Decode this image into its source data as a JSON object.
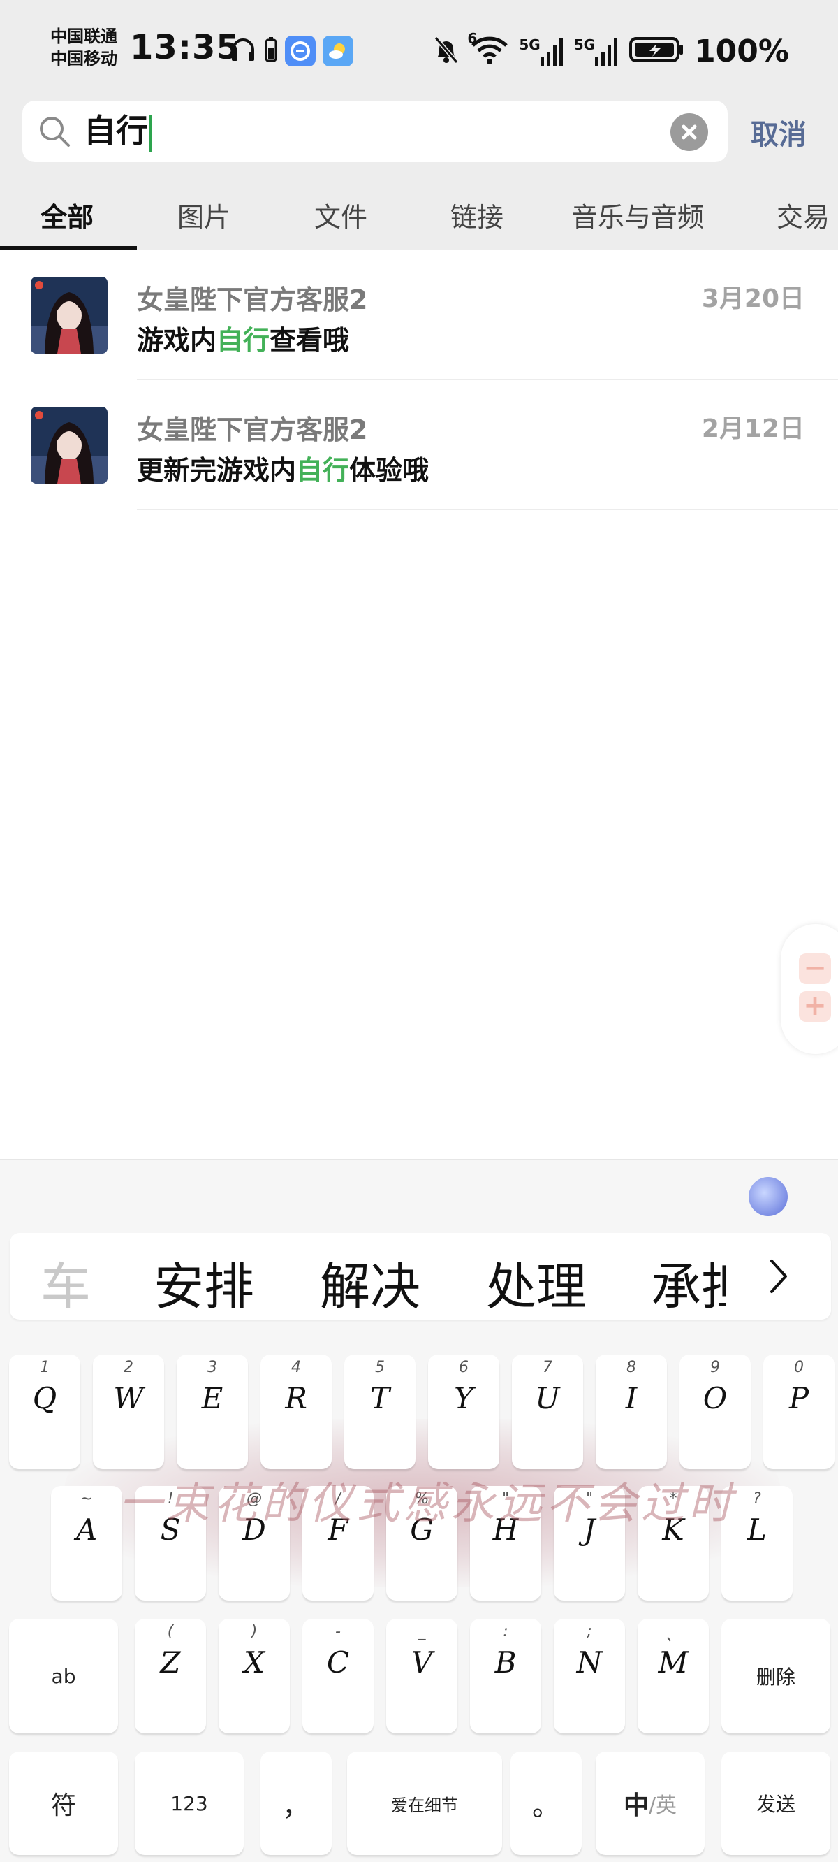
{
  "status_bar": {
    "carrier_1": "中国联通",
    "carrier_2": "中国移动",
    "time": "13:35",
    "network_1": "5G",
    "network_2": "5G",
    "wifi_label": "6",
    "battery": "100%",
    "left_icons": [
      "headphones-icon",
      "battery-small-icon",
      "browser-app-icon",
      "weather-app-icon"
    ],
    "right_icons": [
      "bell-muted-icon",
      "wifi-icon",
      "signal-icon",
      "signal-icon",
      "battery-charging-icon"
    ]
  },
  "search": {
    "query": "自行",
    "cancel_label": "取消"
  },
  "tabs": [
    {
      "label": "全部",
      "active": true
    },
    {
      "label": "图片",
      "active": false
    },
    {
      "label": "文件",
      "active": false
    },
    {
      "label": "链接",
      "active": false
    },
    {
      "label": "音乐与音频",
      "active": false
    },
    {
      "label": "交易",
      "active": false
    }
  ],
  "results": [
    {
      "name": "女皇陛下官方客服2",
      "date": "3月20日",
      "msg_before": "游戏内",
      "msg_highlight": "自行",
      "msg_after": "查看哦"
    },
    {
      "name": "女皇陛下官方客服2",
      "date": "2月12日",
      "msg_before": "更新完游戏内",
      "msg_highlight": "自行",
      "msg_after": "体验哦"
    }
  ],
  "zoom": {
    "minus": "−",
    "plus": "+"
  },
  "keyboard": {
    "candidates": [
      "车",
      "安排",
      "解决",
      "处理",
      "承担"
    ],
    "row1": [
      {
        "pri": "Q",
        "sec": "1"
      },
      {
        "pri": "W",
        "sec": "2"
      },
      {
        "pri": "E",
        "sec": "3"
      },
      {
        "pri": "R",
        "sec": "4"
      },
      {
        "pri": "T",
        "sec": "5"
      },
      {
        "pri": "Y",
        "sec": "6"
      },
      {
        "pri": "U",
        "sec": "7"
      },
      {
        "pri": "I",
        "sec": "8"
      },
      {
        "pri": "O",
        "sec": "9"
      },
      {
        "pri": "P",
        "sec": "0"
      }
    ],
    "row2": [
      {
        "pri": "A",
        "sec": "~"
      },
      {
        "pri": "S",
        "sec": "!"
      },
      {
        "pri": "D",
        "sec": "@"
      },
      {
        "pri": "F",
        "sec": "/"
      },
      {
        "pri": "G",
        "sec": "%"
      },
      {
        "pri": "H",
        "sec": "\""
      },
      {
        "pri": "J",
        "sec": "\""
      },
      {
        "pri": "K",
        "sec": "*"
      },
      {
        "pri": "L",
        "sec": "?"
      }
    ],
    "row3_left": "ab",
    "row3": [
      {
        "pri": "Z",
        "sec": "("
      },
      {
        "pri": "X",
        "sec": ")"
      },
      {
        "pri": "C",
        "sec": "-"
      },
      {
        "pri": "V",
        "sec": "_"
      },
      {
        "pri": "B",
        "sec": ":"
      },
      {
        "pri": "N",
        "sec": ";"
      },
      {
        "pri": "M",
        "sec": "、"
      }
    ],
    "delete_label": "删除",
    "symbol_label": "符",
    "num_label": "123",
    "comma_label": "，",
    "space_label": "爱在细节",
    "period_label": "。",
    "lang_cn": "中",
    "lang_en": "/英",
    "send_label": "发送",
    "watermark": "一束花的仪式感永远不会过时"
  },
  "colors": {
    "highlight": "#43b158",
    "cancel": "#576b95",
    "background": "#ededed"
  }
}
